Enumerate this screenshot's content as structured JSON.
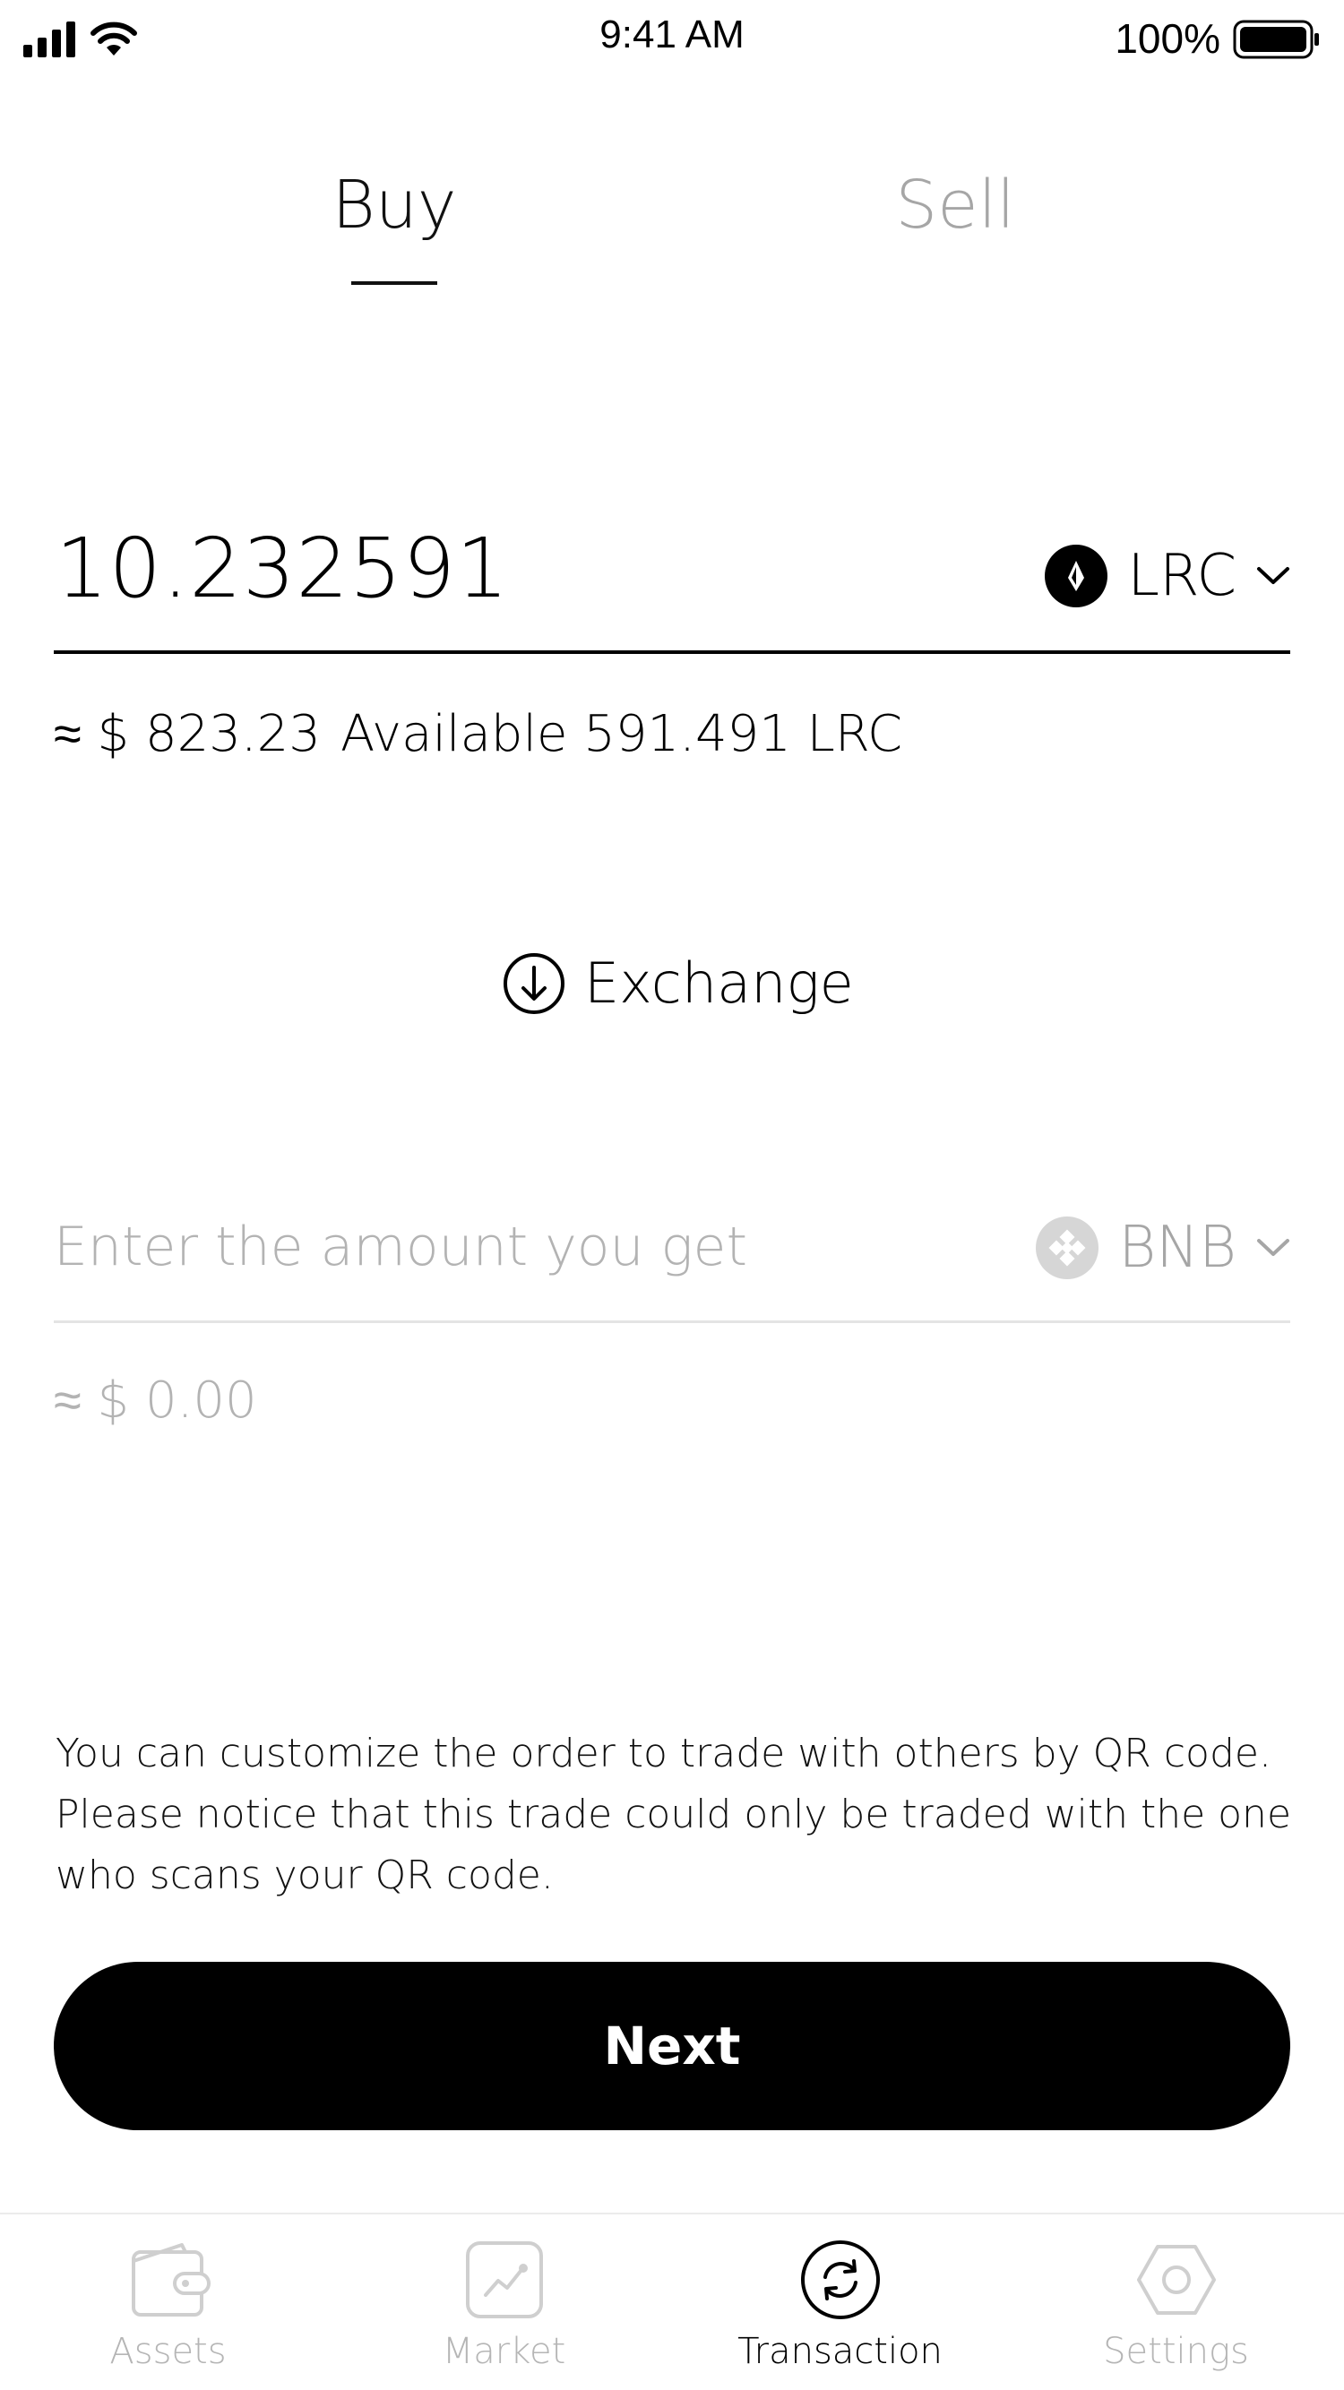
{
  "status_bar": {
    "time": "9:41 AM",
    "battery": "100%",
    "signal_icon": "cellular-signal-icon",
    "wifi_icon": "wifi-icon",
    "battery_icon": "battery-icon"
  },
  "tabs": {
    "buy": "Buy",
    "sell": "Sell",
    "active": "buy"
  },
  "pay": {
    "amount": "10.232591",
    "token": "LRC",
    "token_icon": "loopring-coin-icon",
    "usd_value": "≈ $ 823.23",
    "available": "Available 591.491 LRC"
  },
  "exchange": {
    "label": "Exchange",
    "icon": "arrow-down-circle-icon"
  },
  "get": {
    "placeholder": "Enter the amount you get",
    "value": "",
    "token": "BNB",
    "token_icon": "binance-coin-icon",
    "usd_value": "≈ $ 0.00"
  },
  "note": "You can customize the order to trade with others by QR code.\nPlease notice that this trade could only be traded with the one\nwho scans your QR code.",
  "next_button": "Next",
  "tab_bar": {
    "items": [
      {
        "label": "Assets",
        "icon": "wallet-icon",
        "active": false
      },
      {
        "label": "Market",
        "icon": "chart-icon",
        "active": false
      },
      {
        "label": "Transaction",
        "icon": "exchange-icon",
        "active": true
      },
      {
        "label": "Settings",
        "icon": "hexagon-settings-icon",
        "active": false
      }
    ]
  },
  "colors": {
    "primary": "#000000",
    "muted_text": "#a6a6a6",
    "divider": "#e4e4e4",
    "background": "#ffffff"
  }
}
